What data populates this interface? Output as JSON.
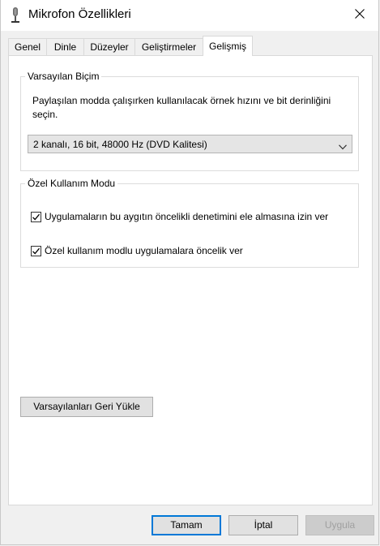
{
  "window": {
    "title": "Mikrofon Özellikleri",
    "icon": "microphone-icon",
    "close_icon": "close-icon"
  },
  "tabs": [
    {
      "label": "Genel"
    },
    {
      "label": "Dinle"
    },
    {
      "label": "Düzeyler"
    },
    {
      "label": "Geliştirmeler"
    },
    {
      "label": "Gelişmiş"
    }
  ],
  "active_tab": "Gelişmiş",
  "default_format": {
    "legend": "Varsayılan Biçim",
    "description": "Paylaşılan modda çalışırken kullanılacak örnek hızını ve bit derinliğini seçin.",
    "selected_value": "2 kanalı, 16 bit, 48000 Hz (DVD Kalitesi)"
  },
  "exclusive_mode": {
    "legend": "Özel Kullanım Modu",
    "options": [
      {
        "label": "Uygulamaların bu aygıtın öncelikli denetimini ele almasına izin ver",
        "checked": true
      },
      {
        "label": "Özel kullanım modlu uygulamalara öncelik ver",
        "checked": true
      }
    ]
  },
  "restore_defaults_label": "Varsayılanları Geri Yükle",
  "footer": {
    "ok_label": "Tamam",
    "cancel_label": "İptal",
    "apply_label": "Uygula"
  },
  "colors": {
    "accent": "#0078d7",
    "panel_bg": "#ffffff",
    "window_bg": "#f0f0f0"
  }
}
